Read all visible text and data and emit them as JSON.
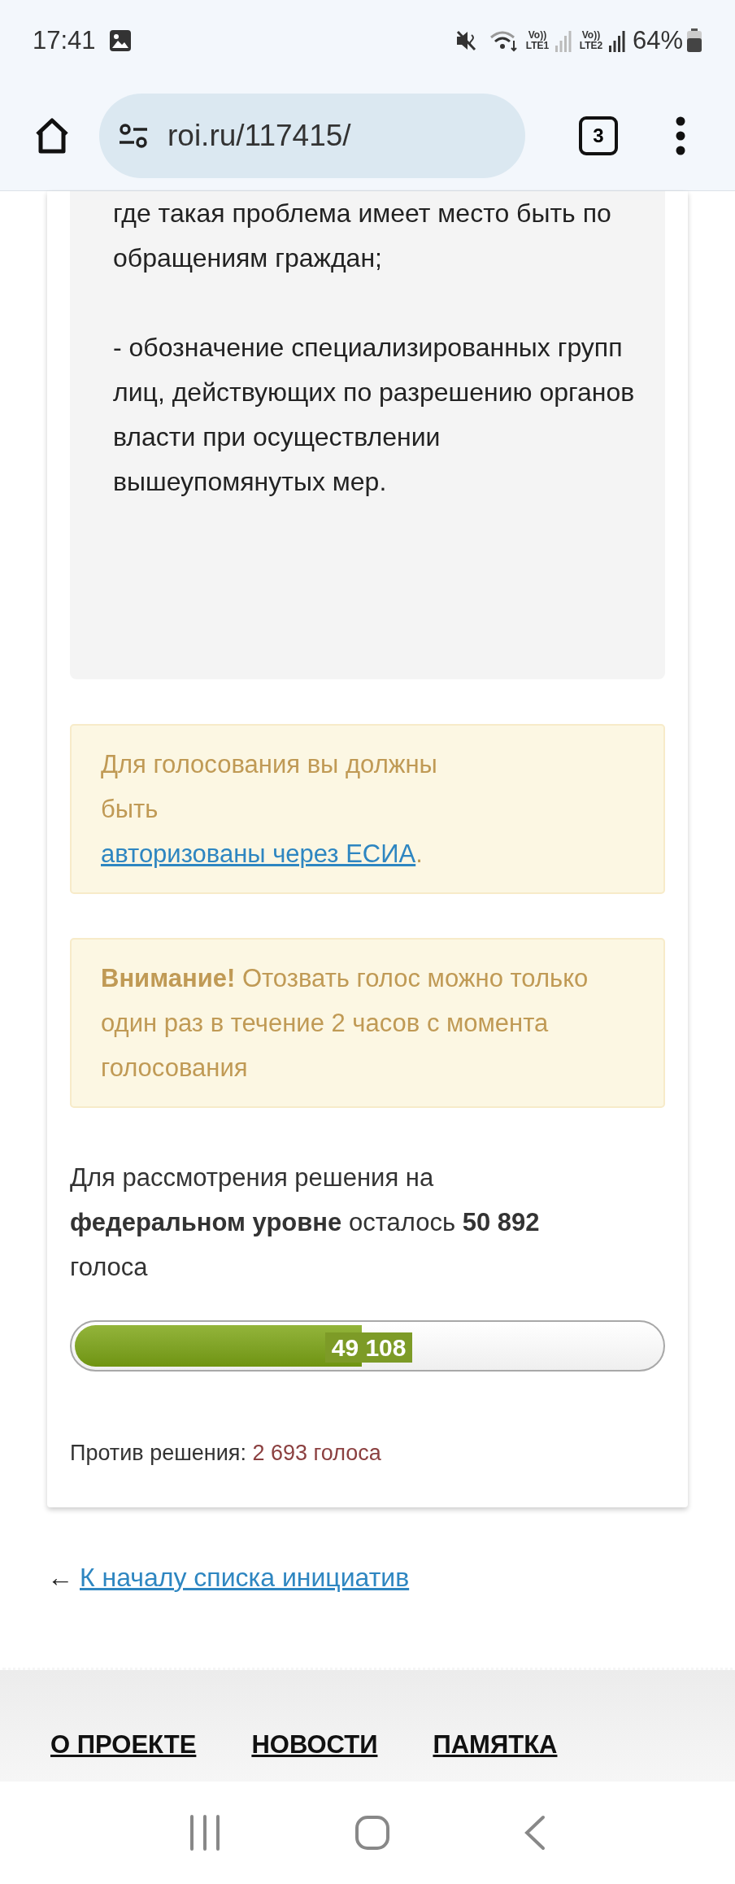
{
  "status_bar": {
    "time": "17:41",
    "sim_labels": [
      "Vo)) LTE1",
      "Vo)) LTE2"
    ],
    "battery": "64%"
  },
  "browser": {
    "url": "roi.ru/117415/",
    "tab_count": "3"
  },
  "petition_text": [
    "где такая проблема имеет место быть по обращениям граждан;",
    "- обозначение специализированных групп лиц, действующих по разрешению органов власти при осуществлении вышеупомянутых мер."
  ],
  "notices": [
    {
      "kind": "auth",
      "text": "Для голосования вы должны быть ",
      "link": "авторизованы через ЕСИА",
      "suffix": "."
    },
    {
      "kind": "warning",
      "text": "**Внимание!** Отозвать голос можно только один раз в течение 2 часов с момента голосования"
    }
  ],
  "vote_status": "Для рассмотрения решения на **федеральном уровне** осталось **50 892** голоса",
  "progress": {
    "level": 0.49,
    "label": "49 108"
  },
  "against": {
    "label": "Против решения:",
    "value": "2 693 голоса"
  },
  "back_link": {
    "arrow": "←",
    "text": "К началу списка инициатив"
  },
  "footer_links": [
    "О ПРОЕКТЕ",
    "НОВОСТИ",
    "ПАМЯТКА"
  ]
}
